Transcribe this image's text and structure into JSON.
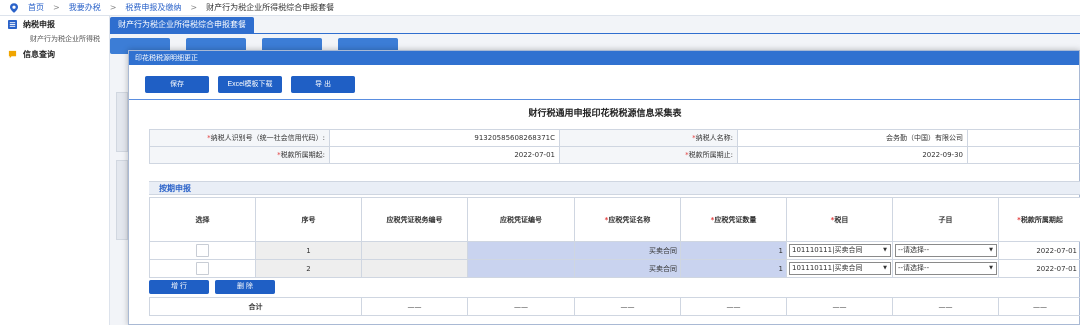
{
  "breadcrumb": {
    "items": [
      "首页",
      "我要办税",
      "税费申报及缴纳",
      "财产行为税企业所得税综合申报套餐"
    ],
    "separator": ">"
  },
  "sidebar": {
    "sections": [
      {
        "label": "纳税申报",
        "sub": "财产行为税企业所得税"
      },
      {
        "label": "信息查询"
      }
    ]
  },
  "page_tab": "财产行为税企业所得税综合申报套餐",
  "dialog": {
    "title": "印花税税源明细更正",
    "buttons": {
      "save": "保存",
      "excel": "Excel模板下载",
      "export": "导 出"
    },
    "form_title": "财行税通用申报印花税税源信息采集表",
    "info": {
      "taxpayer_id_label": "纳税人识别号（统一社会信用代码）:",
      "taxpayer_id": "91320585608268371C",
      "taxpayer_name_label": "纳税人名称:",
      "taxpayer_name": "会务勤（中国）有限公司",
      "period_start_label": "税款所属期起:",
      "period_start": "2022-07-01",
      "period_end_label": "税款所属期止:",
      "period_end": "2022-09-30"
    },
    "section_title": "按期申报",
    "table": {
      "headers": [
        "选择",
        "序号",
        "应税凭证税务编号",
        "应税凭证编号",
        "应税凭证名称",
        "应税凭证数量",
        "税目",
        "子目",
        "税款所属期起"
      ],
      "required": [
        false,
        false,
        false,
        false,
        true,
        true,
        true,
        false,
        true
      ],
      "rows": [
        {
          "seq": "1",
          "voucher_name": "买卖合同",
          "quantity": "1",
          "tax_item": "101110111|买卖合同",
          "sub_item": "--请选择--",
          "period_start": "2022-07-01"
        },
        {
          "seq": "2",
          "voucher_name": "买卖合同",
          "quantity": "1",
          "tax_item": "101110111|买卖合同",
          "sub_item": "--请选择--",
          "period_start": "2022-07-01"
        }
      ],
      "add_row": "增 行",
      "delete_row": "删 除",
      "total_label": "合计",
      "dash": "——"
    }
  },
  "colors": {
    "primary": "#1f5fc5",
    "header_blue": "#3071d0",
    "required": "#e23b3b",
    "cell_blue": "#c9d3ef"
  }
}
